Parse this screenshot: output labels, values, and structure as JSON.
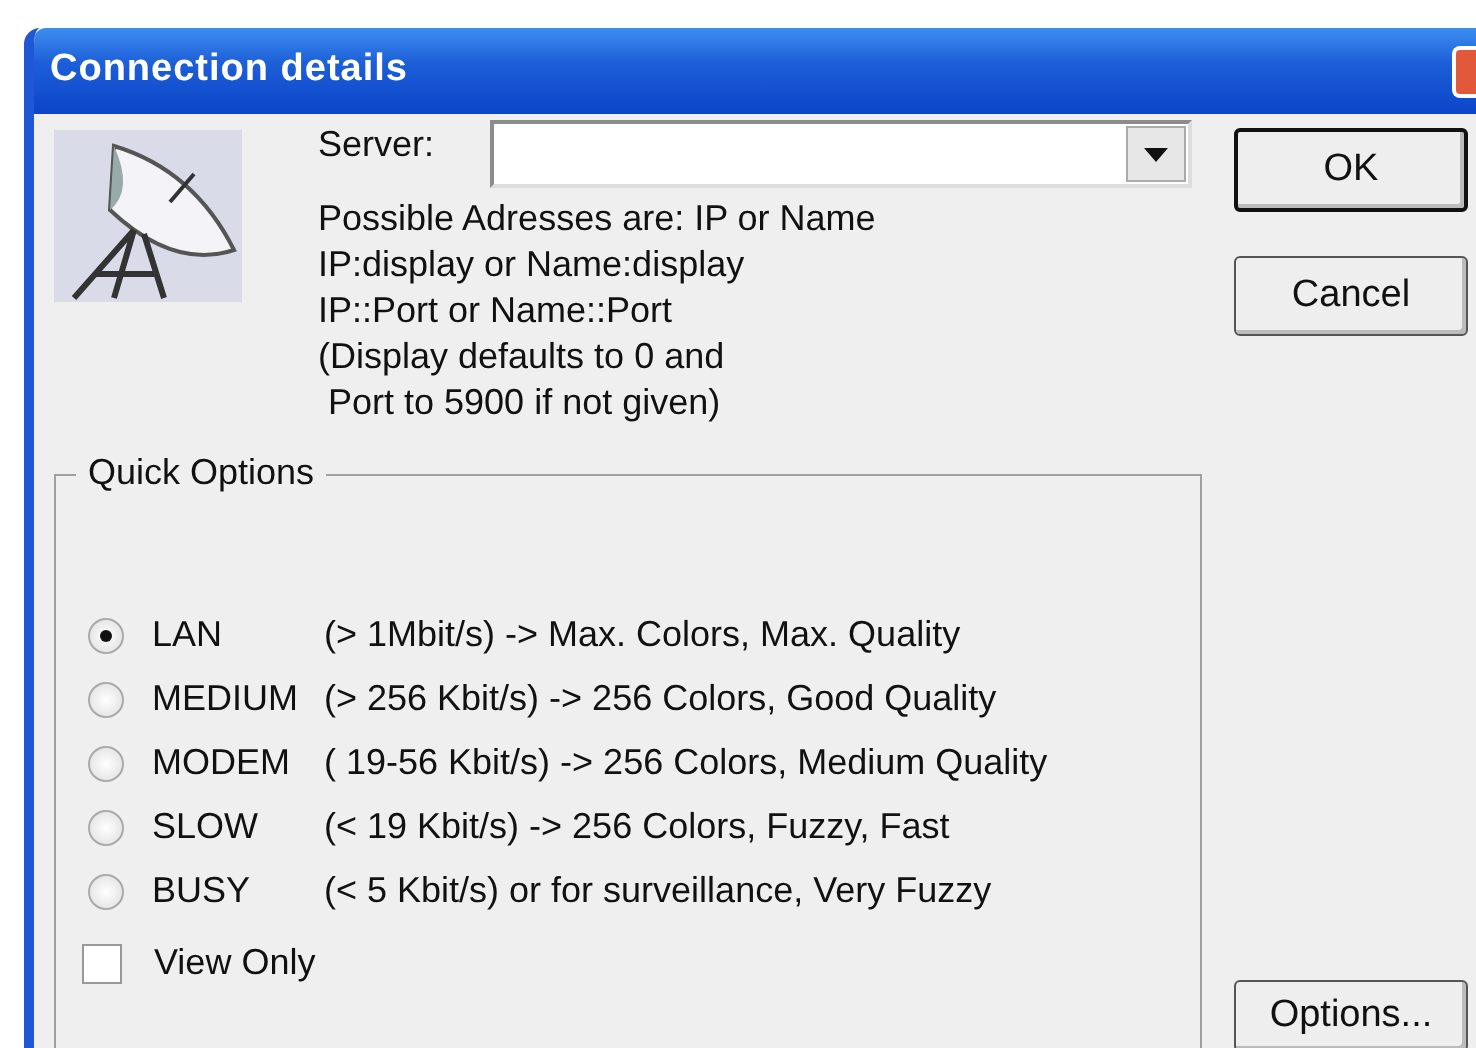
{
  "window": {
    "title": "Connection details"
  },
  "server": {
    "label": "Server:"
  },
  "hints": [
    "Possible Adresses are: IP or Name",
    "IP:display or Name:display",
    "IP::Port or Name::Port",
    "(Display defaults to 0 and",
    " Port to 5900 if not given)"
  ],
  "quick_options": {
    "title": "Quick Options",
    "options": [
      {
        "label": "LAN",
        "description": "(> 1Mbit/s) -> Max. Colors, Max. Quality",
        "selected": true
      },
      {
        "label": "MEDIUM",
        "description": "(> 256 Kbit/s) -> 256 Colors, Good Quality",
        "selected": false
      },
      {
        "label": "MODEM",
        "description": "( 19-56 Kbit/s) -> 256 Colors, Medium Quality",
        "selected": false
      },
      {
        "label": "SLOW",
        "description": "(< 19 Kbit/s) -> 256 Colors, Fuzzy, Fast",
        "selected": false
      },
      {
        "label": "BUSY",
        "description": "(< 5 Kbit/s) or for surveillance, Very Fuzzy",
        "selected": false
      }
    ],
    "view_only": {
      "label": "View Only",
      "checked": false
    }
  },
  "buttons": [
    {
      "label": "OK",
      "default": true
    },
    {
      "label": "Cancel",
      "default": false
    }
  ],
  "options_button": {
    "label": "Options..."
  }
}
